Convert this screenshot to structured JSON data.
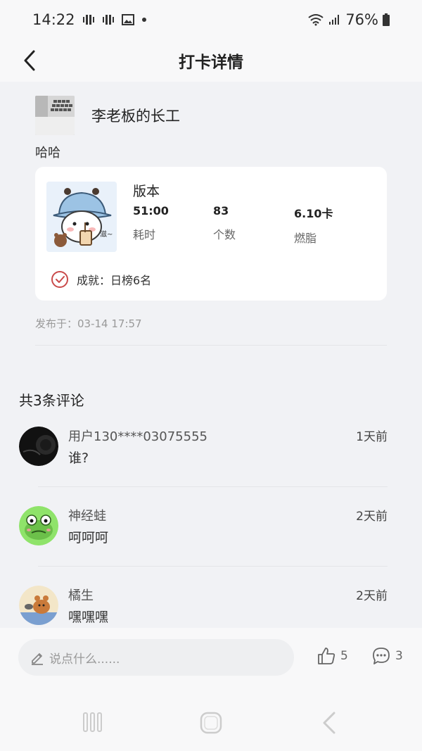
{
  "status_bar": {
    "time": "14:22",
    "battery": "76%"
  },
  "header": {
    "title": "打卡详情"
  },
  "post": {
    "author_name": "李老板的长工",
    "text": "哈哈",
    "card": {
      "title": "版本",
      "stats": [
        {
          "value": "51:00",
          "label": "耗时"
        },
        {
          "value": "83",
          "label": "个数"
        },
        {
          "value": "6.10卡",
          "label": "燃脂"
        }
      ],
      "achievement": "成就：日榜6名",
      "thumb_caption": "滋~"
    },
    "publish_time": "发布于：03-14 17:57"
  },
  "comments": {
    "title": "共3条评论",
    "items": [
      {
        "name": "用户130****03075555",
        "text": "谁?",
        "time": "1天前"
      },
      {
        "name": "神经蛙",
        "text": "呵呵呵",
        "time": "2天前"
      },
      {
        "name": "橘生",
        "text": "嘿嘿嘿",
        "time": "2天前"
      }
    ]
  },
  "bottom_bar": {
    "input_placeholder": "说点什么......",
    "like_count": "5",
    "comment_count": "3"
  },
  "colors": {
    "accent_red": "#c94a4a",
    "frog_green": "#6cc04a"
  }
}
